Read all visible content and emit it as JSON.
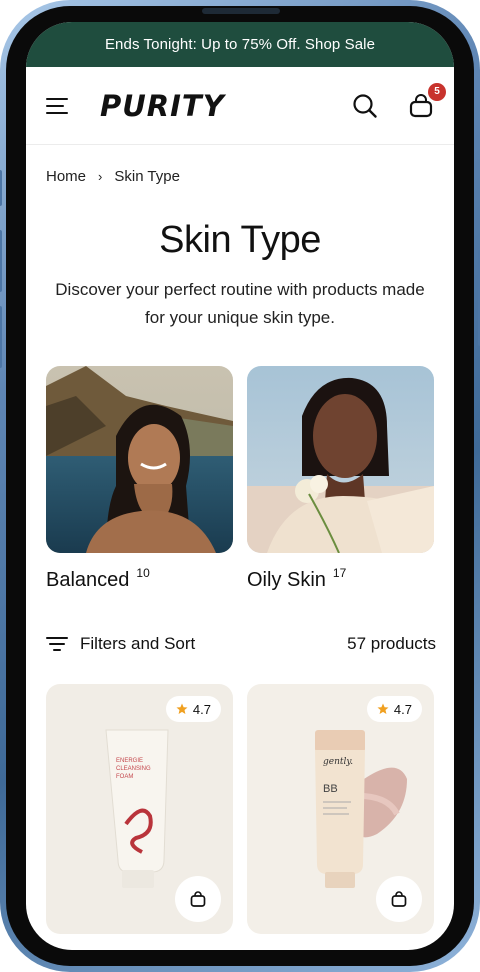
{
  "announcement": "Ends Tonight: Up to 75% Off. Shop Sale",
  "header": {
    "logo": "PURITY",
    "cart_count": "5"
  },
  "breadcrumb": {
    "home": "Home",
    "separator": "›",
    "current": "Skin Type"
  },
  "page": {
    "title": "Skin Type",
    "description": "Discover your perfect routine with products made for your unique skin type."
  },
  "categories": [
    {
      "label": "Balanced",
      "count": "10"
    },
    {
      "label": "Oily Skin",
      "count": "17"
    }
  ],
  "toolbar": {
    "filter_label": "Filters and Sort",
    "product_count": "57 products"
  },
  "products": [
    {
      "rating": "4.7",
      "brand": ""
    },
    {
      "rating": "4.7",
      "brand": "gently."
    }
  ],
  "colors": {
    "announcement_bg": "#1f4d3e",
    "badge": "#c8332d",
    "star": "#f0a020"
  },
  "icons": [
    "menu-icon",
    "search-icon",
    "cart-icon",
    "filter-icon",
    "star-icon",
    "bag-icon"
  ]
}
